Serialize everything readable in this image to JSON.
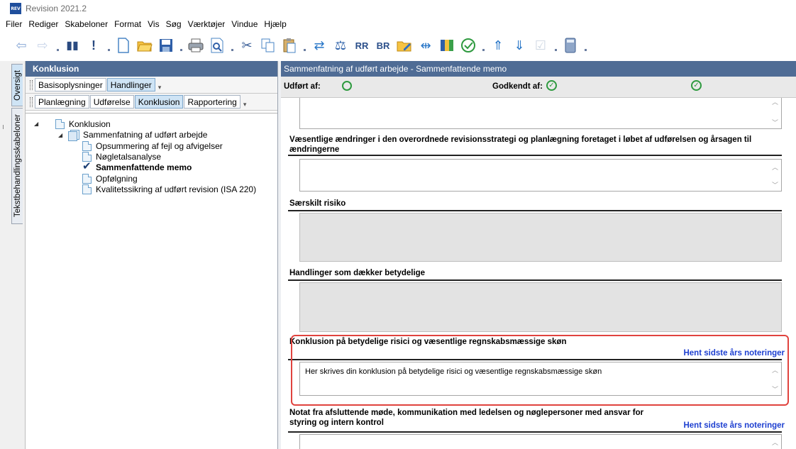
{
  "window": {
    "logo_text": "REV",
    "title": "Revision 2021.2"
  },
  "menu": [
    "Filer",
    "Rediger",
    "Skabeloner",
    "Format",
    "Vis",
    "Søg",
    "Værktøjer",
    "Vindue",
    "Hjælp"
  ],
  "side_tabs": {
    "oversigt": "Oversigt",
    "tekstbehandling": "Tekstbehandlingsskabeloner"
  },
  "left_panel": {
    "header": "Konklusion",
    "tabs_row1": [
      "Basisoplysninger",
      "Handlinger"
    ],
    "tabs_row1_active": "Handlinger",
    "tabs_row2": [
      "Planlægning",
      "Udførelse",
      "Konklusion",
      "Rapportering"
    ],
    "tabs_row2_active": "Konklusion",
    "tree": {
      "root": "Konklusion",
      "group": "Sammenfatning af udført arbejde",
      "items": [
        "Opsummering af fejl og afvigelser",
        "Nøgletalsanalyse",
        "Sammenfattende memo",
        "Opfølgning",
        "Kvalitetssikring af udført revision (ISA 220)"
      ],
      "selected": "Sammenfattende memo"
    }
  },
  "right_panel": {
    "header": "Sammenfatning af udført arbejde - Sammenfattende memo",
    "udfoert_label": "Udført af:",
    "godkendt_label": "Godkendt af:",
    "sections": {
      "vaesentlige": "Væsentlige ændringer i den overordnede revisionsstrategi og planlægning foretaget i løbet af udførelsen og årsagen til ændringerne",
      "saerskilt": "Særskilt risiko",
      "handlinger": "Handlinger som dækker betydelige",
      "konklusion": "Konklusion på betydelige risici og væsentlige regnskabsmæssige skøn",
      "konklusion_text": "Her skrives din konklusion på betydelige risici og væsentlige regnskabsmæssige skøn",
      "notat": "Notat fra afsluttende møde, kommunikation med ledelsen og nøglepersoner med ansvar for styring og intern kontrol"
    },
    "hent_link": "Hent sidste års noteringer"
  },
  "colors": {
    "header_bg": "#4f6c95",
    "accent_green": "#2e9a3f",
    "link_blue": "#1d3fd0",
    "highlight_red": "#e0433e"
  },
  "icons": [
    "back-arrow-icon",
    "forward-arrow-icon",
    "pause-icon",
    "exclamation-icon",
    "new-document-icon",
    "open-folder-icon",
    "save-icon",
    "print-icon",
    "print-preview-icon",
    "cut-icon",
    "copy-icon",
    "paste-icon",
    "transfer-icon",
    "balance-icon",
    "rr-icon",
    "br-icon",
    "folder-edit-icon",
    "signpost-icon",
    "binder-icon",
    "approve-icon",
    "up-arrows-icon",
    "down-arrows-icon",
    "checkbox-icon",
    "calculator-icon"
  ]
}
